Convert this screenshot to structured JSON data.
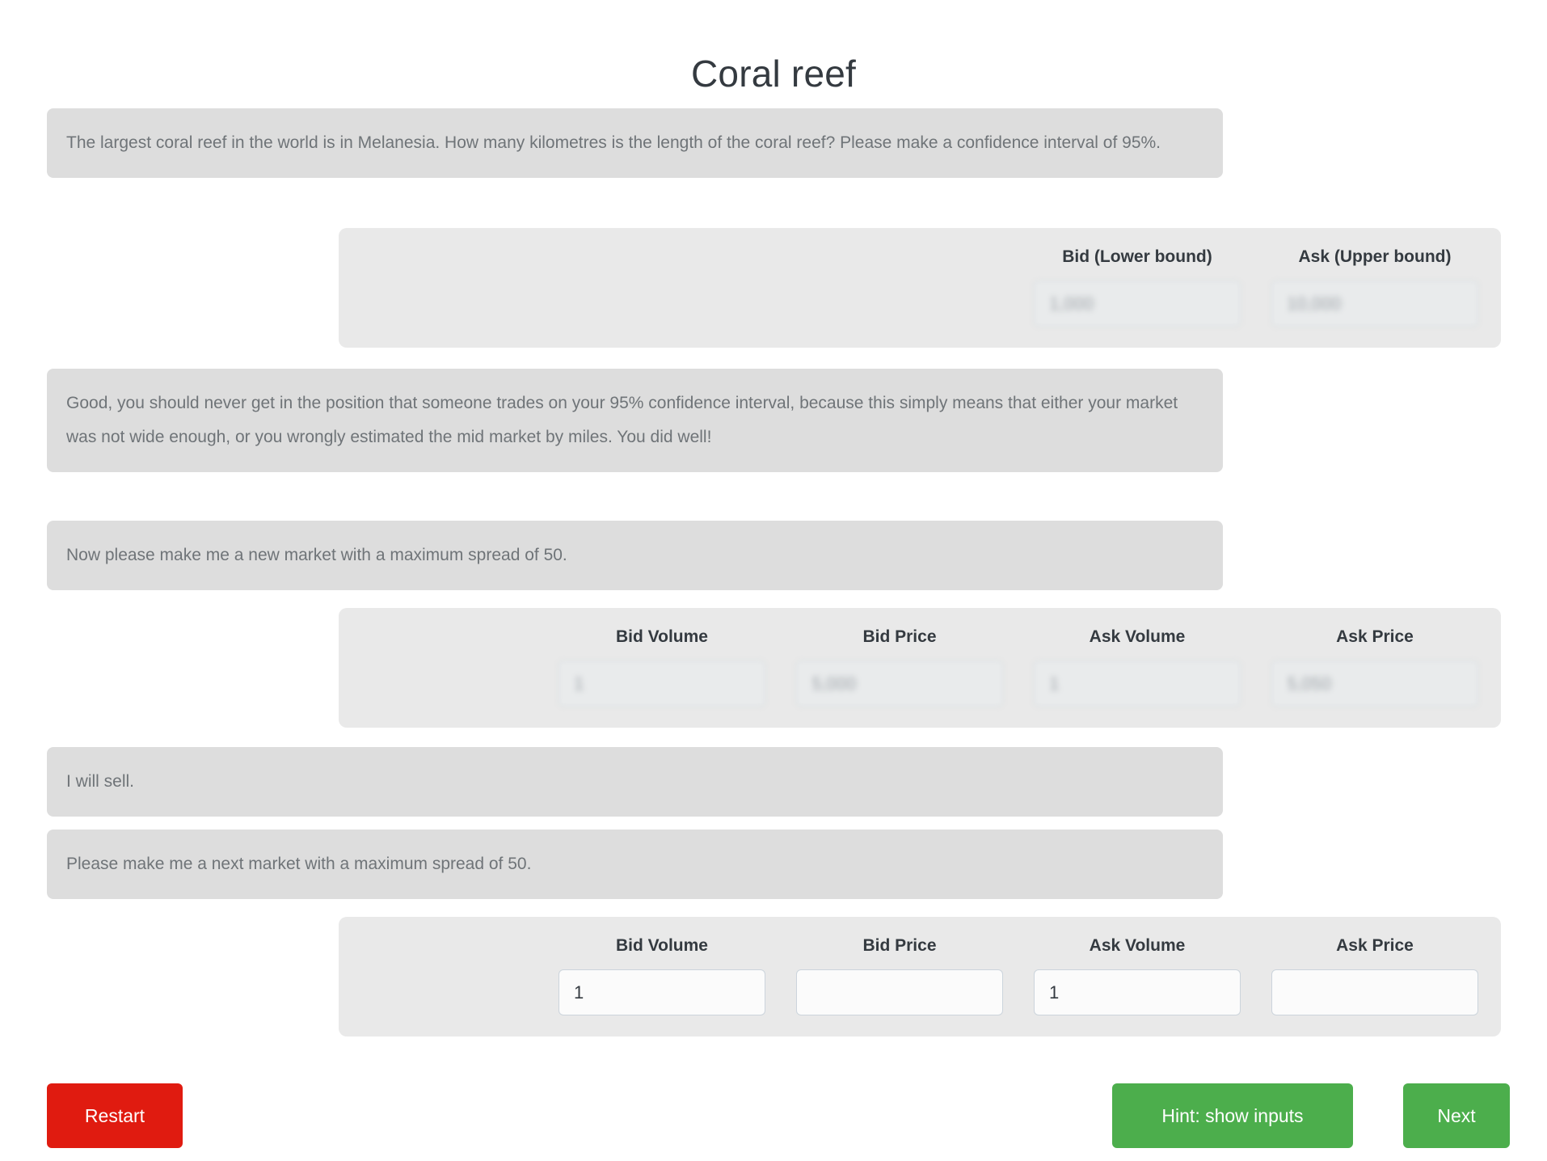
{
  "header": {
    "title": "Coral reef"
  },
  "conversation": [
    {
      "id": "question-prompt",
      "type": "message",
      "text": "The largest coral reef in the world is in Melanesia. How many kilometres is the length of the coral reef? Please make a confidence interval of 95%."
    },
    {
      "id": "confidence-interval-inputs",
      "type": "inputs",
      "disabled": true,
      "fields": [
        {
          "name": "bid-lower-bound",
          "label": "Bid (Lower bound)",
          "value": "1,000",
          "redacted": true
        },
        {
          "name": "ask-upper-bound",
          "label": "Ask (Upper bound)",
          "value": "10,000",
          "redacted": true
        }
      ]
    },
    {
      "id": "feedback-message",
      "type": "message",
      "text": "Good, you should never get in the position that someone trades on your 95% confidence interval, because this simply means that either your market was not wide enough, or you wrongly estimated the mid market by miles. You did well!"
    },
    {
      "id": "new-market-request",
      "type": "message",
      "text": "Now please make me a new market with a maximum spread of 50."
    },
    {
      "id": "market-inputs-1",
      "type": "inputs",
      "disabled": true,
      "fields": [
        {
          "name": "bid-volume",
          "label": "Bid Volume",
          "value": "1",
          "redacted": true
        },
        {
          "name": "bid-price",
          "label": "Bid Price",
          "value": "5,000",
          "redacted": true
        },
        {
          "name": "ask-volume",
          "label": "Ask Volume",
          "value": "1",
          "redacted": true
        },
        {
          "name": "ask-price",
          "label": "Ask Price",
          "value": "5,050",
          "redacted": true
        }
      ]
    },
    {
      "id": "trade-decision",
      "type": "message",
      "text": "I will sell."
    },
    {
      "id": "next-market-request",
      "type": "message",
      "text": "Please make me a next market with a maximum spread of 50."
    },
    {
      "id": "market-inputs-2",
      "type": "inputs",
      "disabled": false,
      "fields": [
        {
          "name": "bid-volume",
          "label": "Bid Volume",
          "value": "1",
          "redacted": false
        },
        {
          "name": "bid-price",
          "label": "Bid Price",
          "value": "",
          "redacted": false
        },
        {
          "name": "ask-volume",
          "label": "Ask Volume",
          "value": "1",
          "redacted": false
        },
        {
          "name": "ask-price",
          "label": "Ask Price",
          "value": "",
          "redacted": false
        }
      ]
    }
  ],
  "footer": {
    "restart_label": "Restart",
    "hint_label": "Hint: show inputs",
    "next_label": "Next"
  },
  "colors": {
    "restart": "#e01b10",
    "hint": "#4cae4c",
    "next": "#4cae4c",
    "bubble_bg": "#dddddd",
    "panel_bg": "#e9e9e9",
    "title": "#343a40"
  }
}
